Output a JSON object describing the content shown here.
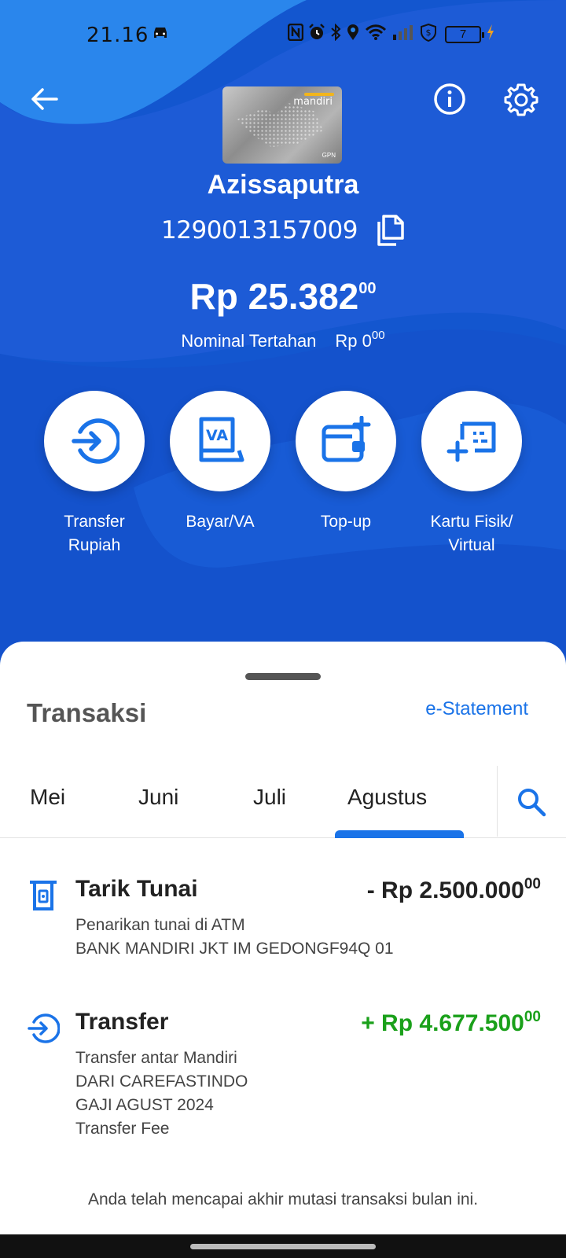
{
  "status_bar": {
    "time": "21.16",
    "battery": "7"
  },
  "account": {
    "card_brand": "mandiri",
    "card_badge": "GPN",
    "name": "Azissaputra",
    "number": "1290013157009",
    "balance": "Rp 25.382",
    "balance_cents": "00",
    "hold_label": "Nominal Tertahan",
    "hold_amount": "Rp 0",
    "hold_cents": "00"
  },
  "actions": [
    {
      "label": "Transfer\nRupiah",
      "icon": "transfer-icon"
    },
    {
      "label": "Bayar/VA",
      "icon": "va-icon"
    },
    {
      "label": "Top-up",
      "icon": "wallet-plus-icon"
    },
    {
      "label": "Kartu Fisik/\nVirtual",
      "icon": "card-plus-icon"
    }
  ],
  "sheet": {
    "title": "Transaksi",
    "estatement": "e-Statement",
    "tabs": [
      "Mei",
      "Juni",
      "Juli",
      "Agustus"
    ],
    "active_tab": "Agustus",
    "end_note": "Anda telah mencapai akhir mutasi transaksi bulan ini."
  },
  "transactions": [
    {
      "title": "Tarik Tunai",
      "amount": "- Rp 2.500.000",
      "cents": "00",
      "direction": "debit",
      "lines": [
        "Penarikan tunai di ATM",
        "BANK MANDIRI JKT IM GEDONGF94Q 01"
      ]
    },
    {
      "title": "Transfer",
      "amount": "+ Rp 4.677.500",
      "cents": "00",
      "direction": "credit",
      "lines": [
        "Transfer antar Mandiri",
        "DARI CAREFASTINDO",
        "GAJI AGUST 2024",
        "Transfer Fee"
      ]
    }
  ],
  "colors": {
    "primary_blue": "#1356cf",
    "accent_blue": "#1a73e8",
    "credit_green": "#1aa01a"
  }
}
